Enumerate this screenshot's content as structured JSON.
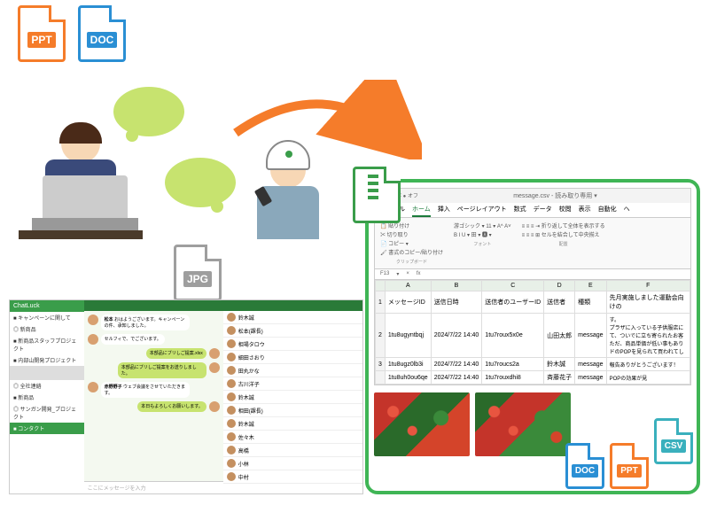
{
  "file_labels": {
    "ppt": "PPT",
    "doc": "DOC",
    "jpg": "JPG",
    "csv": "CSV"
  },
  "chat": {
    "app_name": "ChatLuck",
    "side_groups": [
      "■ キャンペーンに関して",
      "◎ 新商品",
      "■ 新商品スタッフプロジェクト",
      "■ 内部山開発プロジェクト"
    ],
    "side_groups2": [
      "◎ 全社連絡",
      "■ 新商品",
      "◎ サンガン開発_プロジェクト"
    ],
    "bottom": "■ コンタクト",
    "messages": [
      {
        "r": false,
        "name": "松本",
        "text": "おはようございます。キャンペーンの件、承知しました。"
      },
      {
        "r": false,
        "name": "",
        "text": "セルフィで、でございます。"
      },
      {
        "r": true,
        "text": "本部品にブリしご提案.xlsx"
      },
      {
        "r": true,
        "text": "本部品にブリしご提案をお送りしました。"
      },
      {
        "r": false,
        "name": "赤野野子",
        "text": "ウェブ会議をさせていただきます。"
      },
      {
        "r": true,
        "text": "本日もよろしくお願いします。"
      }
    ],
    "placeholder": "ここにメッセージを入力",
    "people": [
      "鈴木誠",
      "松本(課長)",
      "相場タロウ",
      "細田さおり",
      "田丸かな",
      "古川洋子",
      "鈴木誠",
      "相田(課長)",
      "鈴木誠",
      "佐々木",
      "高橋",
      "小林",
      "中村"
    ]
  },
  "excel": {
    "autosave": "自動保存 ● オフ",
    "filename": "message.csv",
    "mode": "読み取り専用 ▾",
    "tabs": [
      "ファイル",
      "ホーム",
      "挿入",
      "ページレイアウト",
      "数式",
      "データ",
      "校閲",
      "表示",
      "自動化",
      "ヘ"
    ],
    "active_tab": "ホーム",
    "ribbon": {
      "paste": "貼り付け",
      "cut": "切り取り",
      "copy": "コピー ▾",
      "fmt": "書式のコピー/貼り付け",
      "grp_clip": "クリップボード",
      "font": "游ゴシック",
      "size": "11",
      "grp_font": "フォント",
      "wrap": "折り返して全体を表示する",
      "merge": "セルを結合して中央揃え",
      "grp_align": "配置"
    },
    "cellref": "F13",
    "fx": "fx",
    "cols": [
      "",
      "A",
      "B",
      "C",
      "D",
      "E",
      "F"
    ],
    "headers": [
      "",
      "メッセージID",
      "送信日時",
      "送信者のユーザーID",
      "送信者",
      "種類",
      "メッセージ"
    ],
    "rows": [
      {
        "n": "1",
        "id": "",
        "dt": "",
        "uid": "",
        "sender": "",
        "type": "",
        "msg": "先月実施しました運動会向けの"
      },
      {
        "n": "2",
        "id": "1tu8ugyntbqj",
        "dt": "2024/7/22 14:40",
        "uid": "1tu7roux5x0e",
        "sender": "山田太郎",
        "type": "message",
        "msg": "す。\nプラザに入っている子供服店に\nて、ついでに立ち寄られたお客\nただ、商品単価が低い事もあり\nドのPOPを見られて買われてし"
      },
      {
        "n": "3",
        "id": "1tu8ugz0lb3i",
        "dt": "2024/7/22 14:40",
        "uid": "1tu7roucs2a",
        "sender": "鈴木誠",
        "type": "message",
        "msg": "報告ありがとうございます！"
      },
      {
        "n": "",
        "id": "1tu8uh0ou6qe",
        "dt": "2024/7/22 14:40",
        "uid": "1tu7rouxdhi8",
        "sender": "斉藤花子",
        "type": "message",
        "msg": "POPの効果が見"
      }
    ]
  }
}
